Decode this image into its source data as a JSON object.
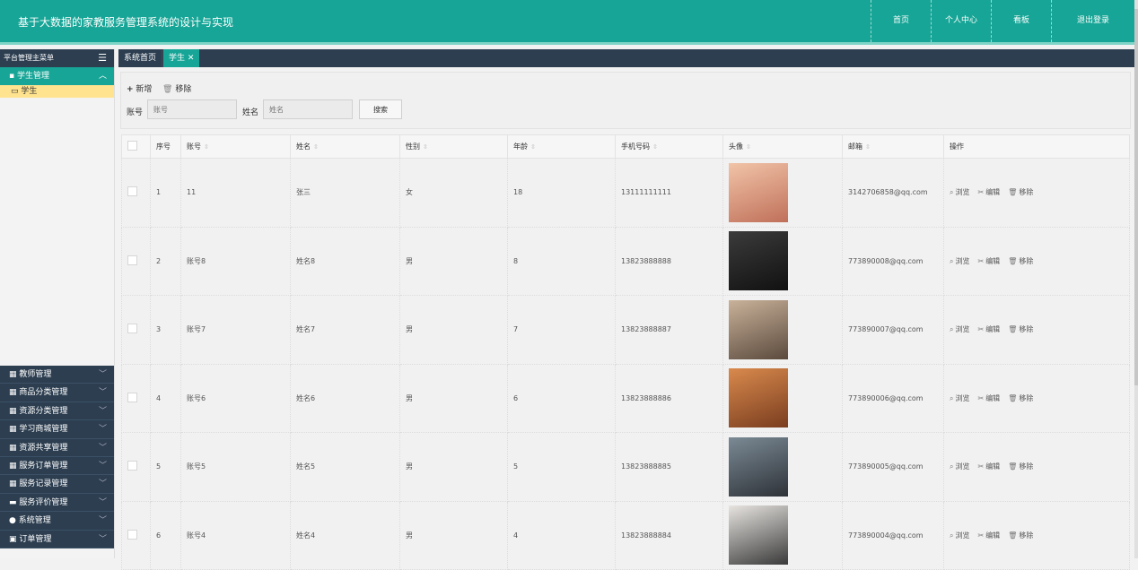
{
  "header": {
    "title": "基于大数据的家教服务管理系统的设计与实现",
    "nav": [
      {
        "label": "首页"
      },
      {
        "label": "个人中心"
      },
      {
        "label": "看板"
      },
      {
        "label": "退出登录"
      }
    ]
  },
  "sidebar": {
    "title": "平台管理主菜单",
    "active_menu": "学生管理",
    "active_sub": "学生",
    "menus": [
      "教师管理",
      "商品分类管理",
      "资源分类管理",
      "学习商城管理",
      "资源共享管理",
      "服务订单管理",
      "服务记录管理",
      "服务评价管理",
      "系统管理",
      "订单管理"
    ]
  },
  "tabs": {
    "home": "系统首页",
    "current": "学生 ✕"
  },
  "toolbar": {
    "add_label": "新增",
    "remove_label": "移除",
    "account_label": "账号",
    "account_placeholder": "账号",
    "name_label": "姓名",
    "name_placeholder": "姓名",
    "search_label": "搜索"
  },
  "table": {
    "headers": {
      "index": "序号",
      "account": "账号",
      "name": "姓名",
      "gender": "性别",
      "age": "年龄",
      "phone": "手机号码",
      "avatar": "头像",
      "email": "邮箱",
      "actions": "操作"
    },
    "action_labels": {
      "view": "浏览",
      "edit": "编辑",
      "remove": "移除"
    },
    "rows": [
      {
        "index": "1",
        "account": "11",
        "name": "张三",
        "gender": "女",
        "age": "18",
        "phone": "13111111111",
        "email": "3142706858@qq.com"
      },
      {
        "index": "2",
        "account": "账号8",
        "name": "姓名8",
        "gender": "男",
        "age": "8",
        "phone": "13823888888",
        "email": "773890008@qq.com"
      },
      {
        "index": "3",
        "account": "账号7",
        "name": "姓名7",
        "gender": "男",
        "age": "7",
        "phone": "13823888887",
        "email": "773890007@qq.com"
      },
      {
        "index": "4",
        "account": "账号6",
        "name": "姓名6",
        "gender": "男",
        "age": "6",
        "phone": "13823888886",
        "email": "773890006@qq.com"
      },
      {
        "index": "5",
        "account": "账号5",
        "name": "姓名5",
        "gender": "男",
        "age": "5",
        "phone": "13823888885",
        "email": "773890005@qq.com"
      },
      {
        "index": "6",
        "account": "账号4",
        "name": "姓名4",
        "gender": "男",
        "age": "4",
        "phone": "13823888884",
        "email": "773890004@qq.com"
      }
    ]
  },
  "colors": {
    "primary": "#16a596",
    "dark": "#2c3e50",
    "highlight": "#ffe38f"
  }
}
